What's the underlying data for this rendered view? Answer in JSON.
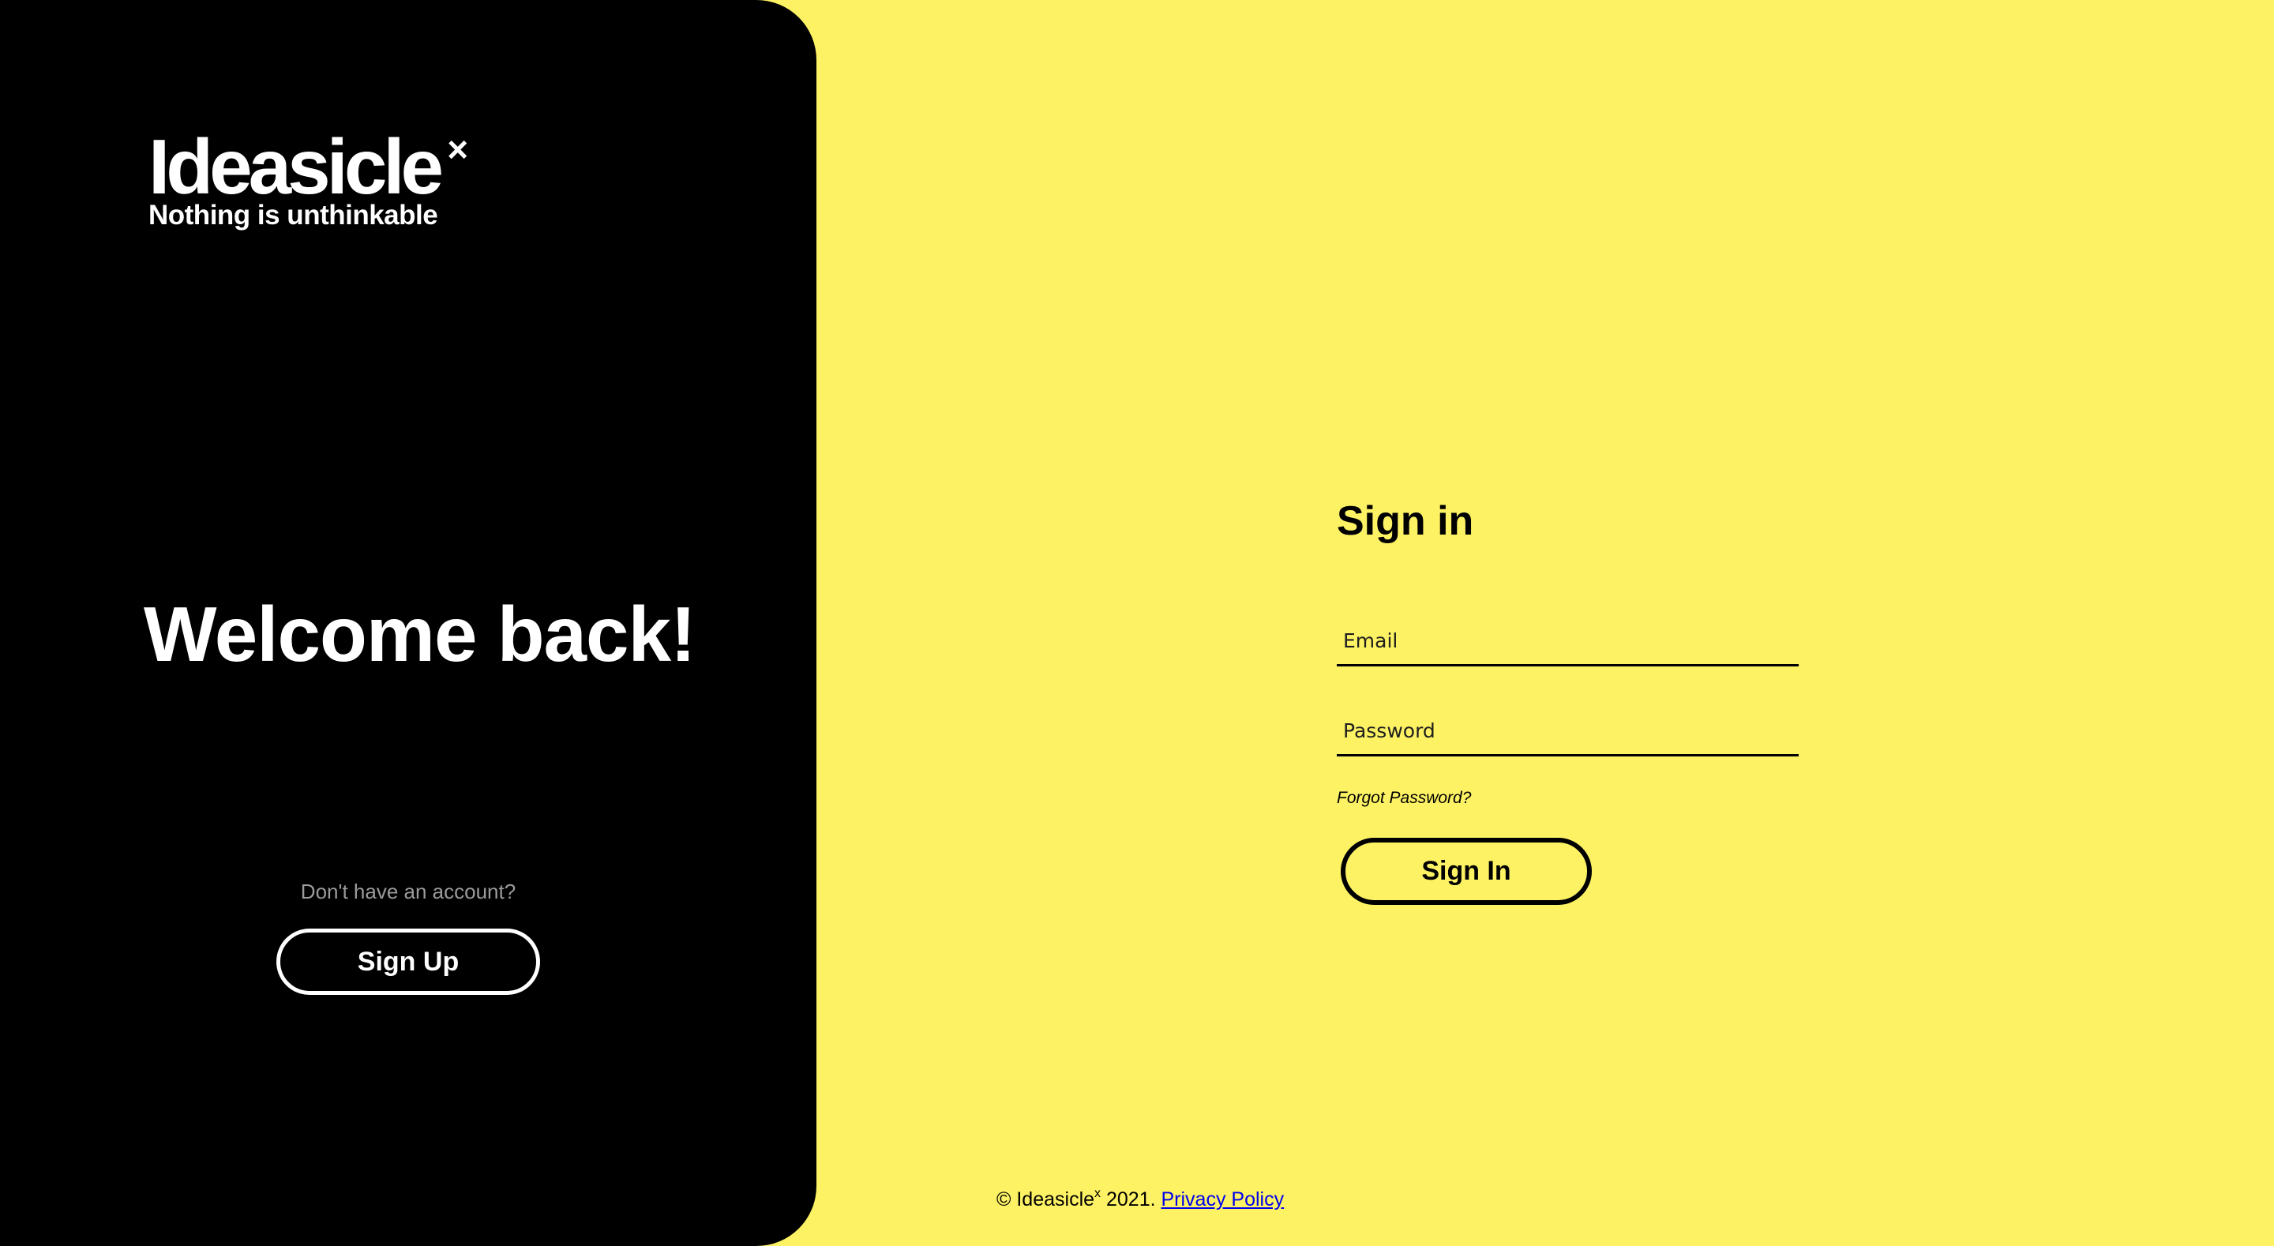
{
  "brand": {
    "wordmark": "Ideasicle",
    "superscript": "×",
    "tagline": "Nothing is unthinkable"
  },
  "left_panel": {
    "welcome": "Welcome back!",
    "no_account_text": "Don't have an account?",
    "signup_label": "Sign Up"
  },
  "form": {
    "title": "Sign in",
    "email": {
      "placeholder": "Email",
      "value": ""
    },
    "password": {
      "placeholder": "Password",
      "value": ""
    },
    "forgot_label": "Forgot Password?",
    "signin_label": "Sign In"
  },
  "footer": {
    "copyright_prefix": "© Ideasicle",
    "superscript": "x",
    "year_text": " 2021. ",
    "privacy_label": "Privacy Policy"
  },
  "colors": {
    "background": "#fdf264",
    "panel": "#000000",
    "text_dark": "#000000",
    "text_light": "#ffffff",
    "muted": "#9b9b9b",
    "link": "#0000ee"
  }
}
